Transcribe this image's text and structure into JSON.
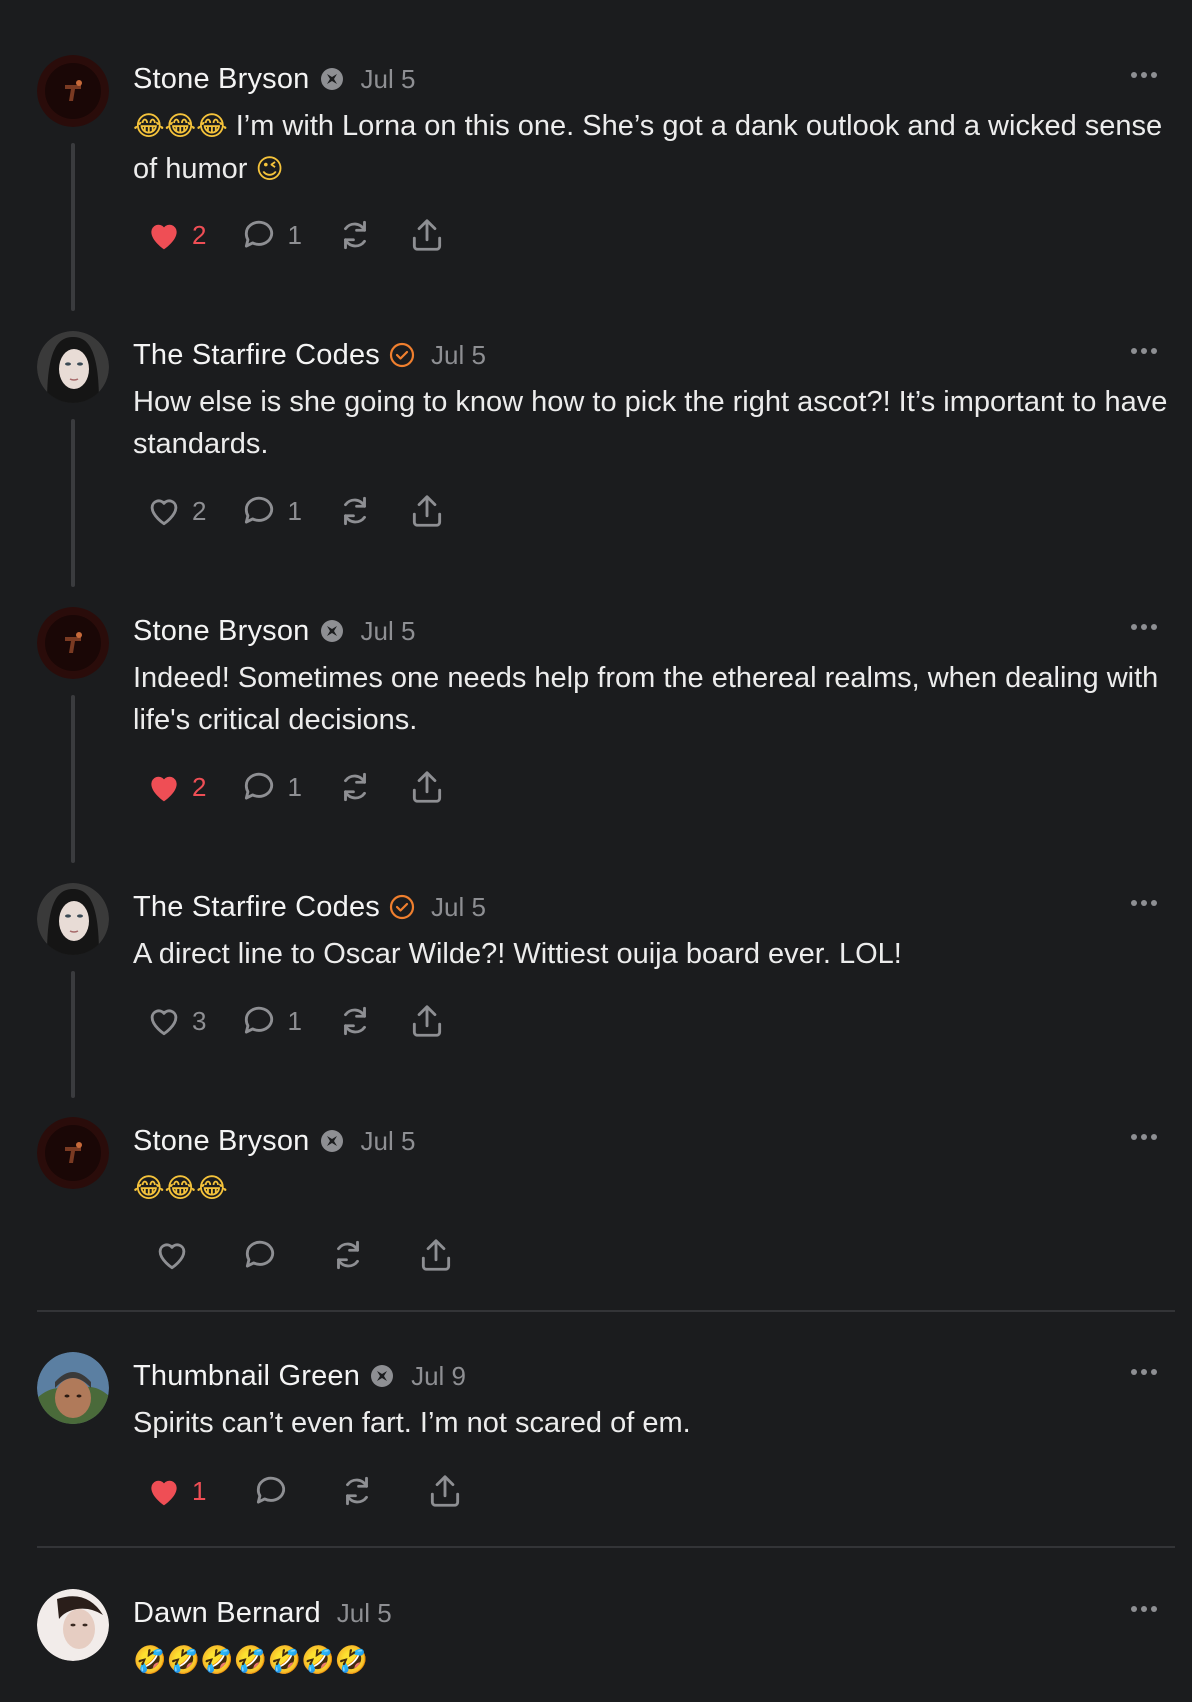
{
  "posts": [
    {
      "author": "Stone Bryson",
      "badge": "community-badge-icon",
      "date": "Jul 5",
      "emoji": "😂😂😂",
      "text": " I’m with Lorna on this one. She’s got a dank outlook and a wicked sense of humor ",
      "text_end_emoji": "😉",
      "likes": "2",
      "liked": true,
      "comments": "1"
    },
    {
      "author": "The Starfire Codes",
      "badge": "verified-badge-icon",
      "date": "Jul 5",
      "text": "How else is she going to know how to pick the right ascot?! It’s important to have standards.",
      "likes": "2",
      "liked": false,
      "comments": "1"
    },
    {
      "author": "Stone Bryson",
      "badge": "community-badge-icon",
      "date": "Jul 5",
      "text": "Indeed! Sometimes one needs help from the ethereal realms, when dealing with life's critical decisions.",
      "likes": "2",
      "liked": true,
      "comments": "1"
    },
    {
      "author": "The Starfire Codes",
      "badge": "verified-badge-icon",
      "date": "Jul 5",
      "text": "A direct line to Oscar Wilde?! Wittiest ouija board ever. LOL!",
      "likes": "3",
      "liked": false,
      "comments": "1"
    },
    {
      "author": "Stone Bryson",
      "badge": "community-badge-icon",
      "date": "Jul 5",
      "emoji": "😂😂😂"
    },
    {
      "author": "Thumbnail Green",
      "badge": "community-badge-icon",
      "date": "Jul 9",
      "text": "Spirits can’t even fart. I’m not scared of em.",
      "likes": "1",
      "liked": true
    },
    {
      "author": "Dawn Bernard",
      "date": "Jul 5",
      "emoji": "🤣🤣🤣🤣🤣🤣🤣"
    }
  ],
  "colors": {
    "background": "#1b1c1e",
    "like_active": "#ef4e55",
    "verified_badge": "#f07f2e",
    "muted_text": "#8e8f93"
  },
  "icons": {
    "like": "heart-icon",
    "comment": "comment-bubble-icon",
    "restack": "restack-icon",
    "share": "share-icon",
    "more": "more-options-icon"
  }
}
